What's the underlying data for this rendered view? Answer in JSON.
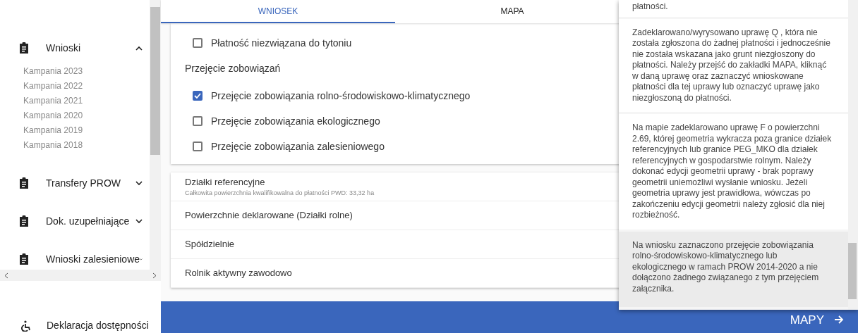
{
  "sidebar": {
    "items": [
      {
        "label": "Wnioski",
        "expanded": true,
        "children": [
          {
            "label": "Kampania 2023"
          },
          {
            "label": "Kampania 2022"
          },
          {
            "label": "Kampania 2021"
          },
          {
            "label": "Kampania 2020"
          },
          {
            "label": "Kampania 2019"
          },
          {
            "label": "Kampania 2018"
          }
        ]
      },
      {
        "label": "Transfery PROW",
        "expanded": false
      },
      {
        "label": "Dok. uzupełniające",
        "expanded": false
      },
      {
        "label": "Wnioski zalesieniowe",
        "expanded": false
      }
    ],
    "footer_link": "Deklaracja dostępności"
  },
  "tabs": [
    {
      "label": "WNIOSEK",
      "selected": true
    },
    {
      "label": "MAPA",
      "selected": false
    }
  ],
  "form": {
    "items": [
      {
        "kind": "checkbox",
        "label": "Płatność niezwiązana do tytoniu",
        "checked": false
      },
      {
        "kind": "heading",
        "label": "Przejęcie zobowiązań"
      },
      {
        "kind": "checkbox",
        "label": "Przejęcie zobowiązania rolno-środowiskowo-klimatycznego",
        "checked": true
      },
      {
        "kind": "checkbox",
        "label": "Przejęcie zobowiązania ekologicznego",
        "checked": false
      },
      {
        "kind": "checkbox",
        "label": "Przejęcie zobowiązania zalesieniowego",
        "checked": false
      }
    ]
  },
  "sections": [
    {
      "title": "Działki referencyjne",
      "subtitle": "Całkowita powierzchnia kwalifikowalna do płatności PWD: 33,32 ha"
    },
    {
      "title": "Powierzchnie deklarowane (Działki rolne)"
    },
    {
      "title": "Spółdzielnie"
    },
    {
      "title": "Rolnik aktywny zawodowo"
    }
  ],
  "messages": [
    {
      "text": "płatności.",
      "selected": false
    },
    {
      "text": "Zadeklarowano/wyrysowano uprawę Q , która nie została zgłoszona do żadnej płatności i jednocześnie nie została wskazana jako grunt niezgłoszony do płatności. Należy przejść do zakładki MAPA, kliknąć w daną uprawę oraz zaznaczyć wnioskowane płatności dla tej uprawy lub oznaczyć uprawę jako niezgłoszoną do płatności.",
      "selected": false
    },
    {
      "text": "Na mapie zadeklarowano uprawę F o powierzchni 2.69, której geometria wykracza poza granice działek referencyjnych lub granice PEG_MKO dla działek referencyjnych w gospodarstwie rolnym. Należy dokonać edycji geometrii uprawy - brak poprawy geometrii uniemożliwi wysłanie wniosku. Jeżeli geometria uprawy jest prawidłowa, wówczas po zakończeniu edycji geometrii należy zgłosić dla niej rozbieżność.",
      "selected": false
    },
    {
      "text": "Na wniosku zaznaczono przejęcie zobowiązania rolno-środowiskowo-klimatycznego lub ekologicznego w ramach PROW 2014-2020 a nie dołączono żadnego związanego z tym przejęciem załącznika.",
      "selected": true
    }
  ],
  "footer_button": "MAPY"
}
